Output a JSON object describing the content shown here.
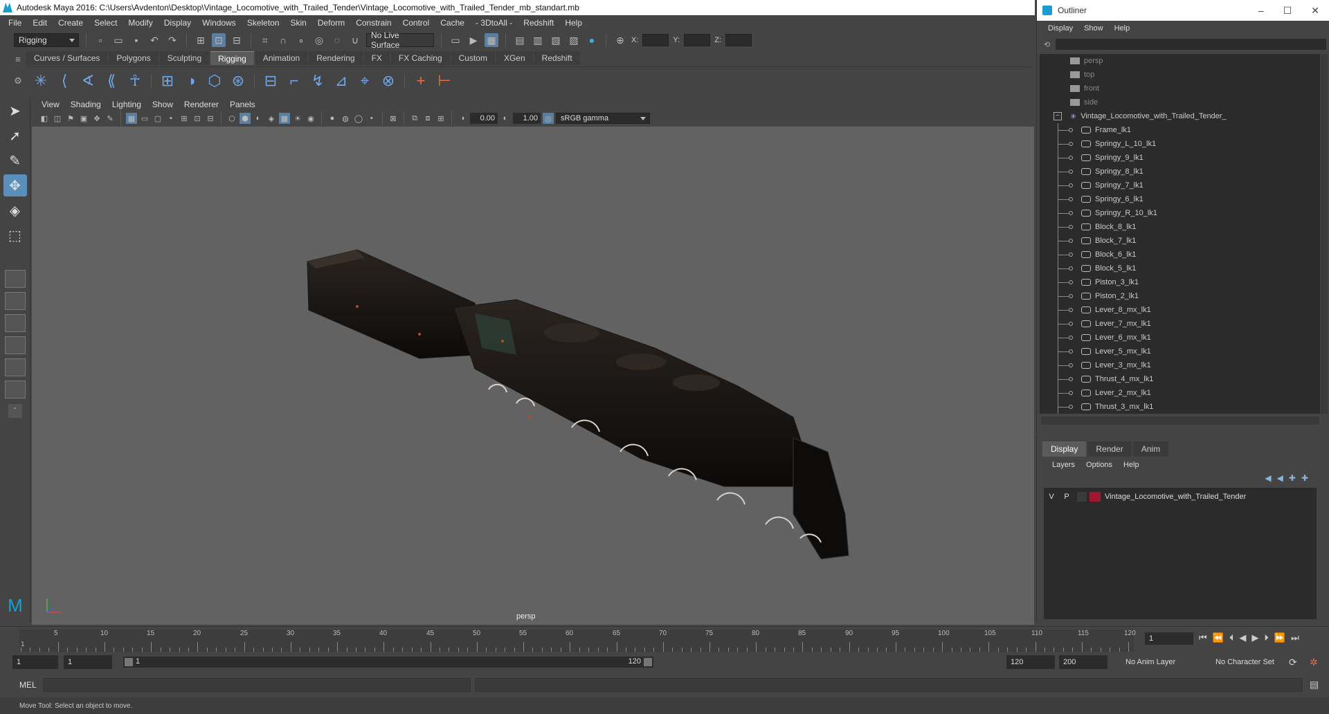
{
  "title_bar": {
    "text": "Autodesk Maya 2016: C:\\Users\\Avdenton\\Desktop\\Vintage_Locomotive_with_Trailed_Tender\\Vintage_Locomotive_with_Trailed_Tender_mb_standart.mb"
  },
  "menubar": [
    "File",
    "Edit",
    "Create",
    "Select",
    "Modify",
    "Display",
    "Windows",
    "Skeleton",
    "Skin",
    "Deform",
    "Constrain",
    "Control",
    "Cache",
    "- 3DtoAll -",
    "Redshift",
    "Help"
  ],
  "statusline": {
    "menuset": "Rigging",
    "live_surface": "No Live Surface",
    "x_label": "X:",
    "y_label": "Y:",
    "z_label": "Z:"
  },
  "shelf": {
    "tabs": [
      "Curves / Surfaces",
      "Polygons",
      "Sculpting",
      "Rigging",
      "Animation",
      "Rendering",
      "FX",
      "FX Caching",
      "Custom",
      "XGen",
      "Redshift"
    ],
    "active_tab": "Rigging"
  },
  "viewport": {
    "menus": [
      "View",
      "Shading",
      "Lighting",
      "Show",
      "Renderer",
      "Panels"
    ],
    "exposure": "0.00",
    "gamma": "1.00",
    "color_space": "sRGB gamma",
    "camera": "persp"
  },
  "outliner": {
    "title": "Outliner",
    "menus": [
      "Display",
      "Show",
      "Help"
    ],
    "cameras": [
      "persp",
      "top",
      "front",
      "side"
    ],
    "root": "Vintage_Locomotive_with_Trailed_Tender_",
    "children": [
      "Frame_lk1",
      "Springy_L_10_lk1",
      "Springy_9_lk1",
      "Springy_8_lk1",
      "Springy_7_lk1",
      "Springy_6_lk1",
      "Springy_R_10_lk1",
      "Block_8_lk1",
      "Block_7_lk1",
      "Block_6_lk1",
      "Block_5_lk1",
      "Piston_3_lk1",
      "Piston_2_lk1",
      "Lever_8_mx_lk1",
      "Lever_7_mx_lk1",
      "Lever_6_mx_lk1",
      "Lever_5_mx_lk1",
      "Lever_3_mx_lk1",
      "Thrust_4_mx_lk1",
      "Lever_2_mx_lk1",
      "Thrust_3_mx_lk1"
    ]
  },
  "layer_editor": {
    "tabs": [
      "Display",
      "Render",
      "Anim"
    ],
    "active_tab": "Display",
    "menus": [
      "Layers",
      "Options",
      "Help"
    ],
    "layer": {
      "v": "V",
      "p": "P",
      "name": "Vintage_Locomotive_with_Trailed_Tender",
      "color": "#a01830"
    }
  },
  "timeline": {
    "labels": [
      "5",
      "10",
      "15",
      "20",
      "25",
      "30",
      "35",
      "40",
      "45",
      "50",
      "55",
      "60",
      "65",
      "70",
      "75",
      "80",
      "85",
      "90",
      "95",
      "100",
      "105",
      "110",
      "115",
      "120"
    ],
    "start_marker": "1",
    "current_frame": "1"
  },
  "range": {
    "start": "1",
    "anim_start": "1",
    "slider_start": "1",
    "slider_end": "120",
    "anim_end": "120",
    "end": "200",
    "anim_layer": "No Anim Layer",
    "character_set": "No Character Set"
  },
  "cmdline": {
    "label": "MEL"
  },
  "helpline": {
    "text": "Move Tool: Select an object to move."
  },
  "colors": {
    "accent": "#5a8ebb",
    "viewport_bg": "#626262",
    "layer_color": "#a01830"
  }
}
